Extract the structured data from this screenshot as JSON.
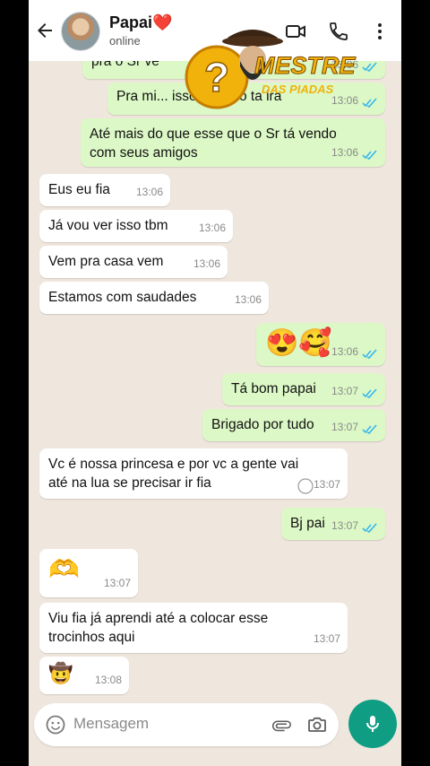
{
  "header": {
    "contact_name": "Papai",
    "heart": "❤️",
    "status": "online",
    "icons": [
      "back-arrow-icon",
      "video-call-icon",
      "phone-icon",
      "more-menu-icon"
    ]
  },
  "watermark": {
    "text_line1": "MESTRE",
    "text_line2": "DAS PIADAS",
    "symbol": "?"
  },
  "messages": [
    {
      "dir": "out",
      "text": "pra o Sr ve",
      "time": "13:06"
    },
    {
      "dir": "out",
      "text": "Pra mi... isso ta irado ta ira",
      "time": "13:06"
    },
    {
      "dir": "out",
      "text": "Até mais do que esse que o Sr tá vendo\ncom seus amigos",
      "time": "13:06"
    },
    {
      "dir": "in",
      "text": "Eus eu fia",
      "time": "13:06"
    },
    {
      "dir": "in",
      "text": "Já vou ver isso tbm",
      "time": "13:06"
    },
    {
      "dir": "in",
      "text": "Vem pra casa vem",
      "time": "13:06"
    },
    {
      "dir": "in",
      "text": "Estamos com saudades",
      "time": "13:06"
    },
    {
      "dir": "out",
      "text": "😍🥰",
      "time": "13:06"
    },
    {
      "dir": "out",
      "text": "Tá bom papai",
      "time": "13:07"
    },
    {
      "dir": "out",
      "text": "Brigado por tudo",
      "time": "13:07"
    },
    {
      "dir": "in",
      "text": "Vc é nossa princesa e por vc a gente vai\naté na lua se precisar ir fia",
      "time": "13:07"
    },
    {
      "dir": "out",
      "text": "Bj pai",
      "time": "13:07"
    },
    {
      "dir": "in",
      "text": "🫶",
      "time": "13:07"
    },
    {
      "dir": "in",
      "text": "Viu fia já aprendi até a colocar esse\ntrocinhos aqui",
      "time": "13:07"
    },
    {
      "dir": "in",
      "text": "🤠",
      "time": "13:08"
    }
  ],
  "input": {
    "placeholder": "Mensagem",
    "icons": [
      "emoji-icon",
      "attach-icon",
      "camera-icon",
      "mic-icon"
    ]
  },
  "colors": {
    "outgoing_bubble": "#dcf8c6",
    "incoming_bubble": "#ffffff",
    "chat_background": "#efe7dd",
    "read_tick": "#34b7f1",
    "mic_button": "#0f9d84"
  }
}
